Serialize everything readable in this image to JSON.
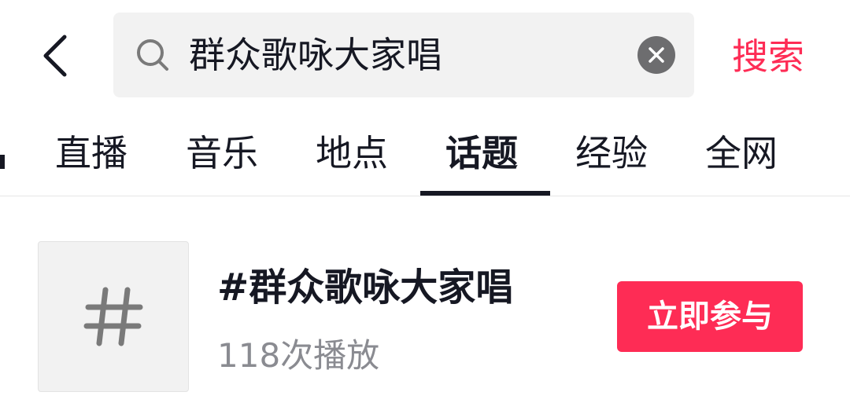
{
  "search": {
    "query": "群众歌咏大家唱",
    "submit_label": "搜索"
  },
  "tabs": [
    {
      "label": "直播",
      "active": false
    },
    {
      "label": "音乐",
      "active": false
    },
    {
      "label": "地点",
      "active": false
    },
    {
      "label": "话题",
      "active": true
    },
    {
      "label": "经验",
      "active": false
    },
    {
      "label": "全网",
      "active": false
    }
  ],
  "topic": {
    "title": "#群众歌咏大家唱",
    "plays": "118次播放",
    "join_label": "立即参与",
    "thumb_symbol": "#"
  },
  "icons": {
    "back": "chevron-left-icon",
    "search": "search-icon",
    "clear": "close-circle-icon",
    "hashtag": "hashtag-icon"
  },
  "colors": {
    "accent": "#fe2c55",
    "text_primary": "#161823",
    "text_secondary": "#8a8b91",
    "search_bg": "#f2f2f2"
  }
}
